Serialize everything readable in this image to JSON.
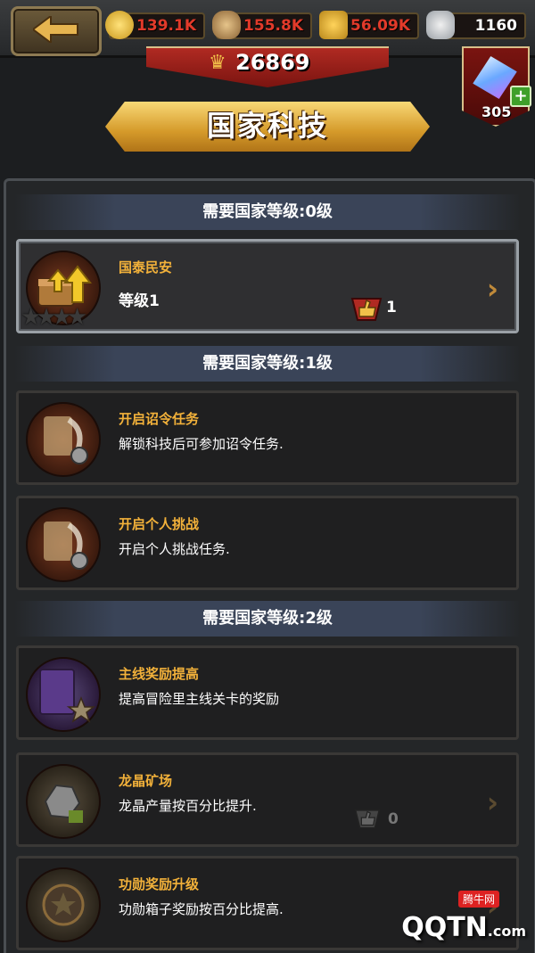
{
  "header": {
    "back_icon": "back-arrow-icon",
    "resources": [
      {
        "icon": "gold-coin-icon",
        "value": "139.1K",
        "color": "#e23a2a"
      },
      {
        "icon": "wood-log-icon",
        "value": "155.8K",
        "color": "#e23a2a"
      },
      {
        "icon": "wheat-icon",
        "value": "56.09K",
        "color": "#e23a2a"
      },
      {
        "icon": "stone-icon",
        "value": "1160",
        "color": "#ffffff"
      }
    ],
    "power": "26869",
    "gems": "305",
    "title": "国家科技"
  },
  "sections": [
    {
      "label": "需要国家等级:0级"
    },
    {
      "label": "需要国家等级:1级"
    },
    {
      "label": "需要国家等级:2级"
    }
  ],
  "techs": [
    {
      "title": "国泰民安",
      "level": "等级1",
      "likes": "1",
      "icon": "treasure-chest-upgrade-icon"
    },
    {
      "title": "开启诏令任务",
      "desc": "解锁科技后可参加诏令任务.",
      "icon": "scroll-quill-icon"
    },
    {
      "title": "开启个人挑战",
      "desc": "开启个人挑战任务.",
      "icon": "scroll-quill-icon"
    },
    {
      "title": "主线奖励提高",
      "desc": "提高冒险里主线关卡的奖励",
      "icon": "book-star-icon"
    },
    {
      "title": "龙晶矿场",
      "desc": "龙晶产量按百分比提升.",
      "likes": "0",
      "icon": "dragon-crystal-ore-icon"
    },
    {
      "title": "功勋奖励升级",
      "desc": "功勋箱子奖励按百分比提高.",
      "icon": "merit-medal-icon"
    }
  ],
  "watermark": {
    "brand": "QQTN",
    "suffix": ".com",
    "tag": "腾牛网"
  }
}
